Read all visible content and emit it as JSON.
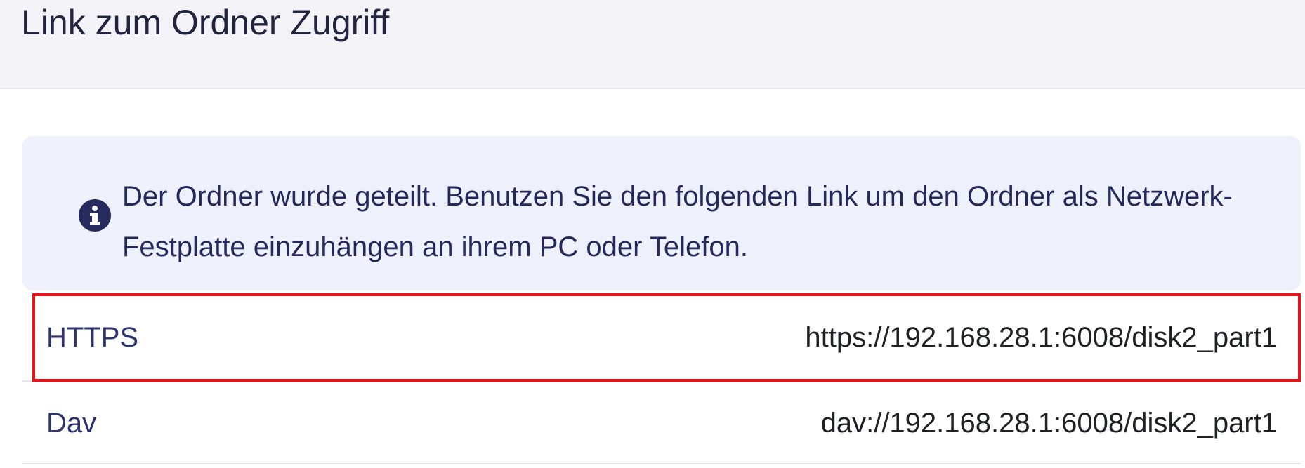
{
  "dialog": {
    "title": "Link zum Ordner Zugriff"
  },
  "info": {
    "icon": "info-circle-icon",
    "message": "Der Ordner wurde geteilt. Benutzen Sie den folgenden Link um den Ordner als Netzwerk-Festplatte einzuhängen an ihrem PC oder Telefon."
  },
  "links": [
    {
      "label": "HTTPS",
      "url": "https://192.168.28.1:6008/disk2_part1"
    },
    {
      "label": "Dav",
      "url": "dav://192.168.28.1:6008/disk2_part1"
    }
  ],
  "colors": {
    "highlight": "#e8141c",
    "info_background": "#eef0fb",
    "header_background": "#f3f3f7",
    "accent": "#262a5c"
  }
}
